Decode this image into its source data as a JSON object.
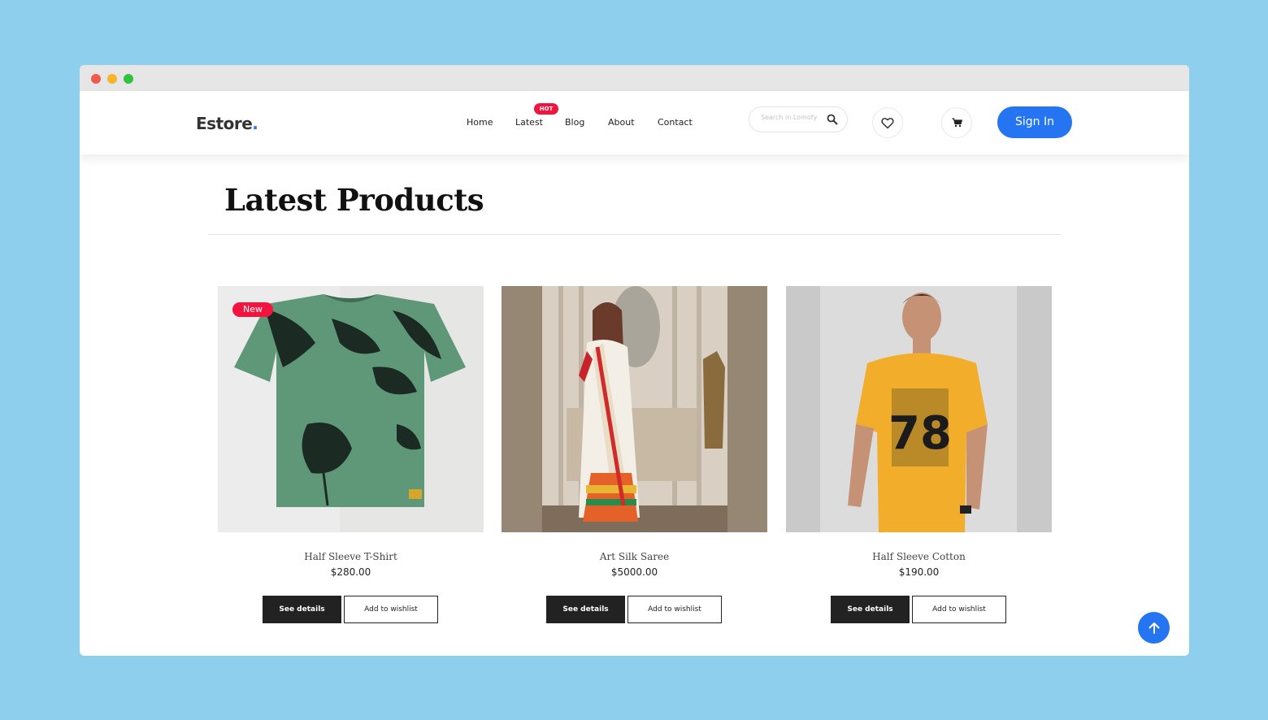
{
  "brand": {
    "name": "Estore",
    "suffix": ".",
    "accent": "#2575f2"
  },
  "nav": {
    "items": [
      {
        "label": "Home"
      },
      {
        "label": "Latest"
      },
      {
        "label": "Blog"
      },
      {
        "label": "About"
      },
      {
        "label": "Contact"
      }
    ],
    "hot_badge": "HOT"
  },
  "search": {
    "placeholder": "Search in Lomofy"
  },
  "signin_label": "Sign In",
  "page": {
    "title": "Latest Products"
  },
  "products": [
    {
      "name": "Half Sleeve T-Shirt",
      "price": "$280.00",
      "badge": "New",
      "details_label": "See details",
      "wishlist_label": "Add to wishlist"
    },
    {
      "name": "Art Silk Saree",
      "price": "$5000.00",
      "details_label": "See details",
      "wishlist_label": "Add to wishlist"
    },
    {
      "name": "Half Sleeve Cotton",
      "price": "$190.00",
      "details_label": "See details",
      "wishlist_label": "Add to wishlist",
      "print_text": "78"
    }
  ],
  "icons": {
    "search": "search-icon",
    "wishlist": "heart-icon",
    "cart": "cart-icon",
    "scroll_top": "arrow-up-icon"
  },
  "colors": {
    "badge": "#f0143f",
    "primary": "#2575f2",
    "dark_button": "#222222"
  }
}
